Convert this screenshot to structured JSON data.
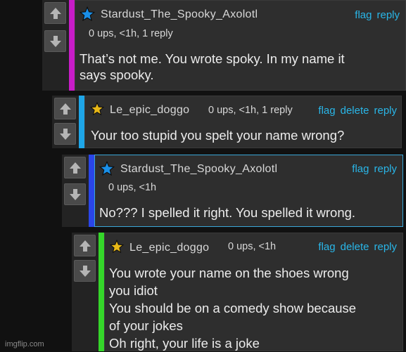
{
  "comments": [
    {
      "username": "Stardust_The_Spooky_Axolotl",
      "star": "blue-star-icon",
      "meta": "0 ups, <1h, 1 reply",
      "actions": [
        "flag",
        "reply"
      ],
      "bar_color": "#c81cc8",
      "lines": [
        "That’s not me. You wrote spoky. In my name it",
        "says spooky."
      ]
    },
    {
      "username": "Le_epic_doggo",
      "star": "gold-star-icon",
      "meta": "0 ups, <1h, 1 reply",
      "actions": [
        "flag",
        "delete",
        "reply"
      ],
      "bar_color": "#1ea6e8",
      "lines": [
        "Your too stupid you spelt your name wrong?"
      ]
    },
    {
      "username": "Stardust_The_Spooky_Axolotl",
      "star": "blue-star-icon",
      "meta": "0 ups, <1h",
      "actions": [
        "flag",
        "reply"
      ],
      "bar_color": "#2a45e8",
      "lines": [
        "No??? I spelled it right. You spelled it wrong."
      ]
    },
    {
      "username": "Le_epic_doggo",
      "star": "gold-star-icon",
      "meta": "0 ups, <1h",
      "actions": [
        "flag",
        "delete",
        "reply"
      ],
      "bar_color": "#35d62a",
      "lines": [
        "You wrote your name on the shoes wrong",
        "you idiot",
        "You should be on a comedy show because",
        "of your jokes",
        "Oh right, your life is a joke"
      ]
    }
  ],
  "watermark": "imgflip.com",
  "colors": {
    "link": "#29b6e8",
    "background": "#111111"
  }
}
